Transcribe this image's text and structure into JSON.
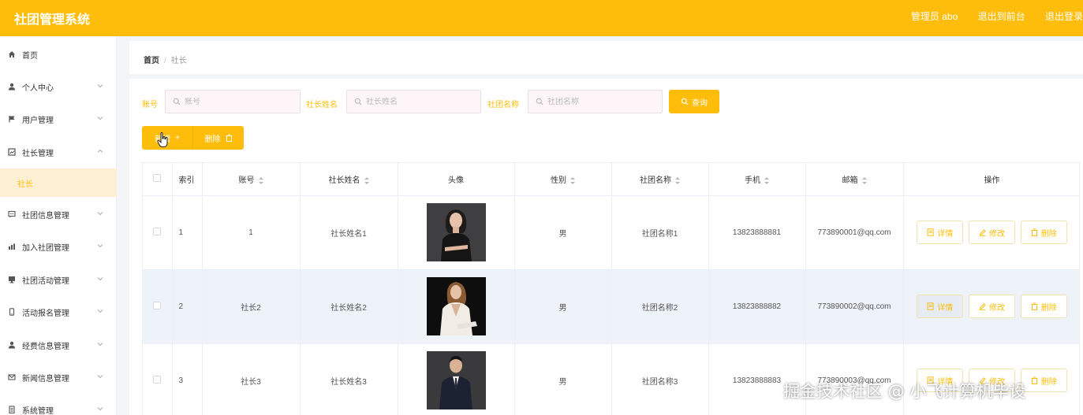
{
  "header": {
    "app_title": "社团管理系统",
    "admin_label": "管理员 abo",
    "to_front_label": "退出到前台",
    "logout_label": "退出登录"
  },
  "sidebar": {
    "items": [
      {
        "label": "首页",
        "icon": "home-icon"
      },
      {
        "label": "个人中心",
        "icon": "user-icon"
      },
      {
        "label": "用户管理",
        "icon": "flag-icon"
      },
      {
        "label": "社长管理",
        "icon": "chart-icon"
      },
      {
        "label": "社长",
        "icon": ""
      },
      {
        "label": "社团信息管理",
        "icon": "message-icon"
      },
      {
        "label": "加入社团管理",
        "icon": "bar-chart-icon"
      },
      {
        "label": "社团活动管理",
        "icon": "monitor-icon"
      },
      {
        "label": "活动报名管理",
        "icon": "phone-icon"
      },
      {
        "label": "经费信息管理",
        "icon": "user-icon"
      },
      {
        "label": "新闻信息管理",
        "icon": "mail-icon"
      },
      {
        "label": "系统管理",
        "icon": "document-icon"
      }
    ]
  },
  "breadcrumb": {
    "home": "首页",
    "separator": "/",
    "current": "社长"
  },
  "filters": {
    "account_label": "账号",
    "account_placeholder": "账号",
    "name_label": "社长姓名",
    "name_placeholder": "社长姓名",
    "club_label": "社团名称",
    "club_placeholder": "社团名称",
    "query_label": "查询"
  },
  "actions": {
    "add_label": "新增",
    "add_glyph": "+",
    "delete_label": "删除"
  },
  "table": {
    "headers": [
      "索引",
      "账号",
      "社长姓名",
      "头像",
      "性别",
      "社团名称",
      "手机",
      "邮箱",
      "操作"
    ],
    "rows": [
      {
        "index": "1",
        "account": "1",
        "name": "社长姓名1",
        "gender": "男",
        "club": "社团名称1",
        "phone": "13823888881",
        "email": "773890001@qq.com"
      },
      {
        "index": "2",
        "account": "社长2",
        "name": "社长姓名2",
        "gender": "男",
        "club": "社团名称2",
        "phone": "13823888882",
        "email": "773890002@qq.com"
      },
      {
        "index": "3",
        "account": "社长3",
        "name": "社长姓名3",
        "gender": "男",
        "club": "社团名称3",
        "phone": "13823888883",
        "email": "773890003@qq.com"
      }
    ],
    "row_actions": {
      "detail": "详情",
      "edit": "修改",
      "delete": "删除"
    }
  },
  "watermark": "掘金技术社区 @ 小飞计算机毕设",
  "colors": {
    "accent": "#fdbd0a",
    "row_alt": "#eef2f9",
    "active_menu_bg": "#fdefd1"
  }
}
